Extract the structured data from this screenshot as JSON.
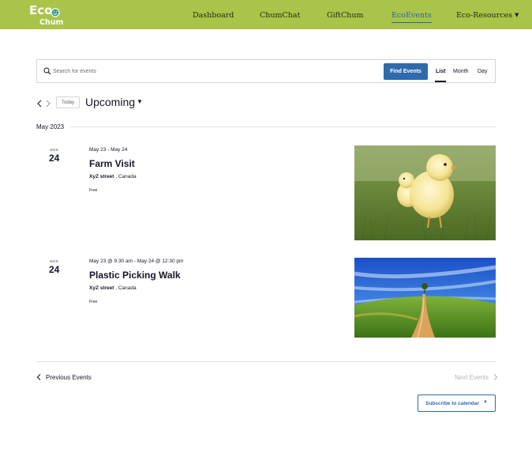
{
  "header": {
    "logo_text_top": "Eco",
    "logo_text_bottom": "Chum",
    "nav": [
      {
        "label": "Dashboard"
      },
      {
        "label": "ChumChat"
      },
      {
        "label": "GiftChum"
      },
      {
        "label": "EcoEvents",
        "active": true
      },
      {
        "label": "Eco-Resources",
        "dropdown": true
      }
    ],
    "colors": {
      "header_bg": "#aac44a",
      "active_link": "#2d5fa8"
    }
  },
  "search": {
    "placeholder": "Search for events",
    "value": "",
    "find_button": "Find Events",
    "views": [
      "List",
      "Month",
      "Day"
    ],
    "active_view": "List",
    "icon": "search-icon"
  },
  "toolbar": {
    "today": "Today",
    "range_label": "Upcoming"
  },
  "month_label": "May 2023",
  "events": [
    {
      "dow": "WED",
      "day": "24",
      "date_range": "May 23 - May 24",
      "title": "Farm Visit",
      "venue": "XyZ street",
      "location": ", Canada",
      "cost": "Free",
      "image": "chicks-on-grass"
    },
    {
      "dow": "WED",
      "day": "24",
      "date_range": "May 23 @ 9:30 am - May 24 @ 12:30 pm",
      "title": "Plastic Picking Walk",
      "venue": "XyZ street",
      "location": ", Canada",
      "cost": "Free",
      "image": "country-road-field"
    }
  ],
  "footer_nav": {
    "previous": "Previous Events",
    "next": "Next Events",
    "subscribe": "Subscribe to calendar"
  },
  "accent_color": "#2f6aad"
}
